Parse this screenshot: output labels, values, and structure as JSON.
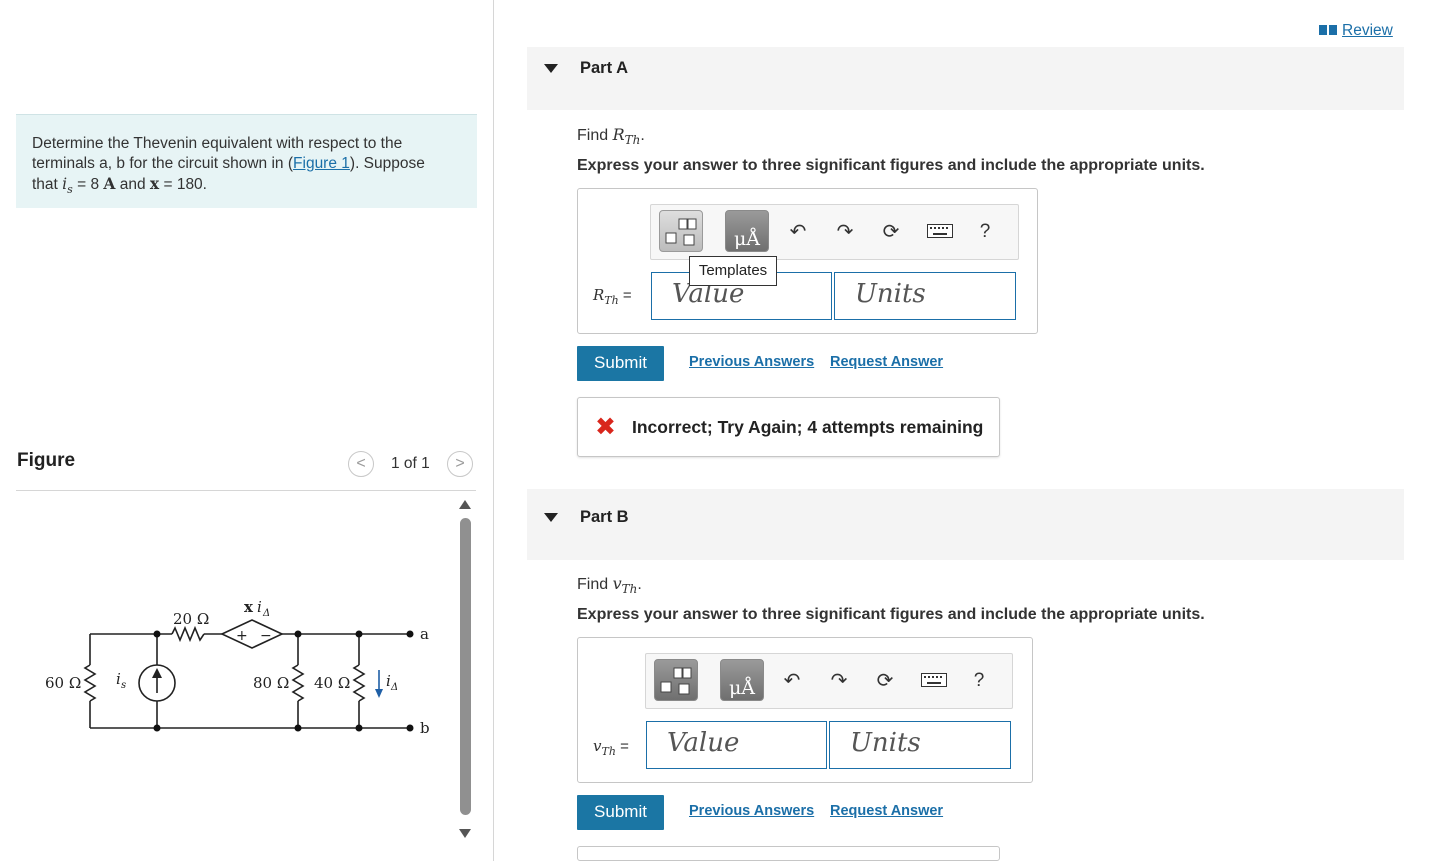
{
  "review": {
    "label": "Review"
  },
  "problem": {
    "line1": "Determine the Thevenin equivalent with respect to the",
    "line2_pre": "terminals a, b for the circuit shown in (",
    "figure_link": "Figure 1",
    "line2_post": "). Suppose",
    "line3_pre": "that",
    "is_var": "i",
    "is_sub": "s",
    "is_value": " = 8 ",
    "is_unit": "A",
    "and_text": " and ",
    "x_var": "x",
    "x_value": " = 180."
  },
  "figure": {
    "title": "Figure",
    "pager": {
      "count": "1 of 1",
      "prev": "<",
      "next": ">"
    },
    "labels": {
      "r20": "20 Ω",
      "xia_x": "x",
      "xia_i": "i",
      "xia_sub": "Δ",
      "r60": "60 Ω",
      "is_i": "i",
      "is_sub": "s",
      "r80": "80 Ω",
      "r40": "40 Ω",
      "ia_i": "i",
      "ia_sub": "Δ",
      "term_a": "a",
      "term_b": "b"
    }
  },
  "partA": {
    "label": "Part A",
    "find_pre": "Find ",
    "var": "R",
    "var_sub": "Th",
    "find_post": ".",
    "instruction": "Express your answer to three significant figures and include the appropriate units.",
    "eq_var": "R",
    "eq_sub": "Th",
    "eq_sign": " =",
    "value_placeholder": "Value",
    "units_placeholder": "Units",
    "tooltip": "Templates",
    "units_btn": "μÅ",
    "help": "?",
    "submit": "Submit",
    "prev_answers": "Previous Answers",
    "request_answer": "Request Answer",
    "feedback": {
      "icon": "✖",
      "text": "Incorrect; Try Again; 4 attempts remaining"
    }
  },
  "partB": {
    "label": "Part B",
    "find_pre": "Find ",
    "var": "v",
    "var_sub": "Th",
    "find_post": ".",
    "instruction": "Express your answer to three significant figures and include the appropriate units.",
    "eq_var": "v",
    "eq_sub": "Th",
    "eq_sign": " =",
    "value_placeholder": "Value",
    "units_placeholder": "Units",
    "units_btn": "μÅ",
    "help": "?",
    "submit": "Submit",
    "prev_answers": "Previous Answers",
    "request_answer": "Request Answer"
  },
  "colors": {
    "accent": "#1b76a4",
    "link": "#1b6fa8",
    "error": "#d9261c",
    "problem_bg": "#e7f4f5"
  },
  "icons": [
    "templates-icon",
    "units-icon",
    "undo-icon",
    "redo-icon",
    "reset-icon",
    "keyboard-icon",
    "help-icon",
    "close-x-icon",
    "book-icon",
    "collapse-triangle-icon"
  ]
}
